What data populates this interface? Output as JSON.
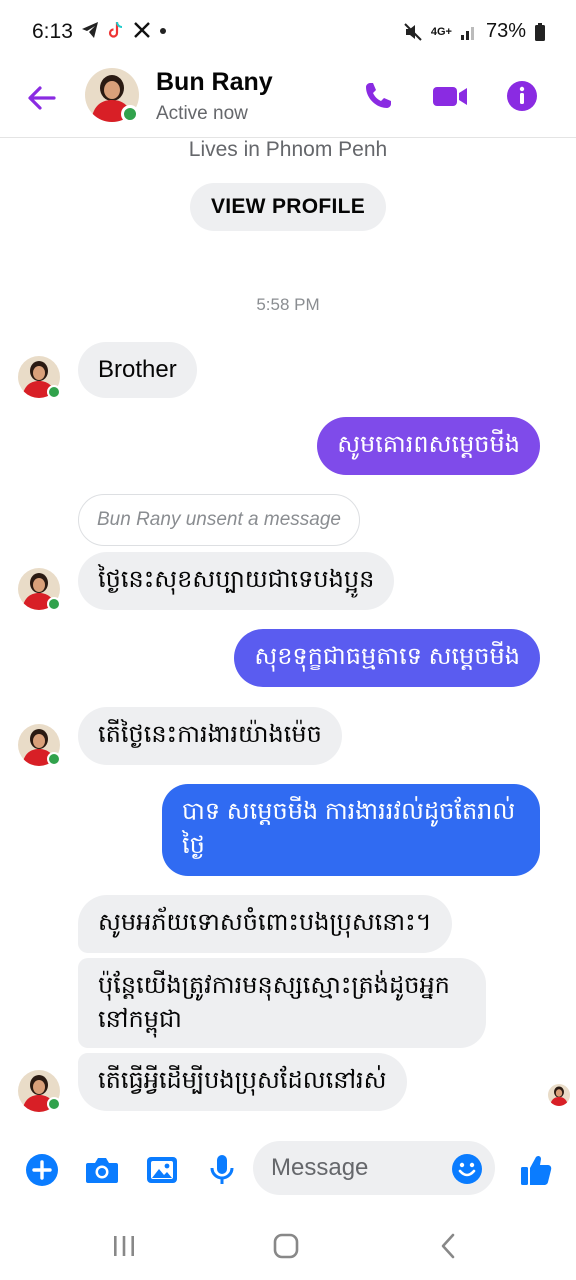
{
  "status_bar": {
    "time": "6:13",
    "network": "4G+",
    "battery": "73%",
    "left_icons": [
      "telegram-icon",
      "tiktok-icon",
      "x-icon",
      "dot-icon"
    ],
    "right_icons": [
      "mute-icon",
      "network-icon",
      "signal-icon",
      "battery-icon"
    ]
  },
  "header": {
    "name": "Bun Rany",
    "status": "Active now",
    "icons": [
      "back-arrow-icon",
      "phone-icon",
      "video-icon",
      "info-icon"
    ]
  },
  "profile": {
    "lives_in": "Lives in Phnom Penh",
    "view_profile_label": "VIEW PROFILE"
  },
  "thread": {
    "timestamp": "5:58 PM",
    "messages": [
      {
        "from": "them",
        "text": "Brother"
      },
      {
        "from": "me",
        "text": "សូមគោរពសម្តេចមីង"
      },
      {
        "from": "system",
        "text": "Bun Rany unsent a message"
      },
      {
        "from": "them",
        "text": "ថ្ងៃនេះសុខសប្បាយជាទេបងប្អូន"
      },
      {
        "from": "me",
        "text": "សុខទុក្ខជាធម្មតាទេ សម្តេចមីង"
      },
      {
        "from": "them",
        "text": "តើថ្ងៃនេះការងារយ៉ាងម៉េច"
      },
      {
        "from": "me",
        "text": "បាទ សម្តេចមីង ការងាររវល់ដូចតែរាល់ថ្ងៃ"
      },
      {
        "from": "them",
        "text": "សូមអភ័យទោសចំពោះបងប្រុសនោះ។"
      },
      {
        "from": "them",
        "text": "ប៉ុន្តែយើងត្រូវការមនុស្សស្មោះត្រង់ដូចអ្នកនៅកម្ពុជា"
      },
      {
        "from": "them",
        "text": "តើធ្វើអ្វីដើម្បីបងប្រុសដែលនៅរស់"
      }
    ]
  },
  "composer": {
    "placeholder": "Message",
    "icons": [
      "plus-icon",
      "camera-icon",
      "gallery-icon",
      "microphone-icon",
      "emoji-icon",
      "thumbs-up-icon"
    ]
  },
  "nav_bar": {
    "icons": [
      "recent-apps-icon",
      "home-icon",
      "back-icon"
    ]
  },
  "colors": {
    "accent": "#8a2be2",
    "outgoing_gradient": [
      "#8e44e8",
      "#5b5cf0",
      "#2f6bf2"
    ],
    "incoming_bubble": "#eeeff1",
    "online": "#31a24c"
  }
}
